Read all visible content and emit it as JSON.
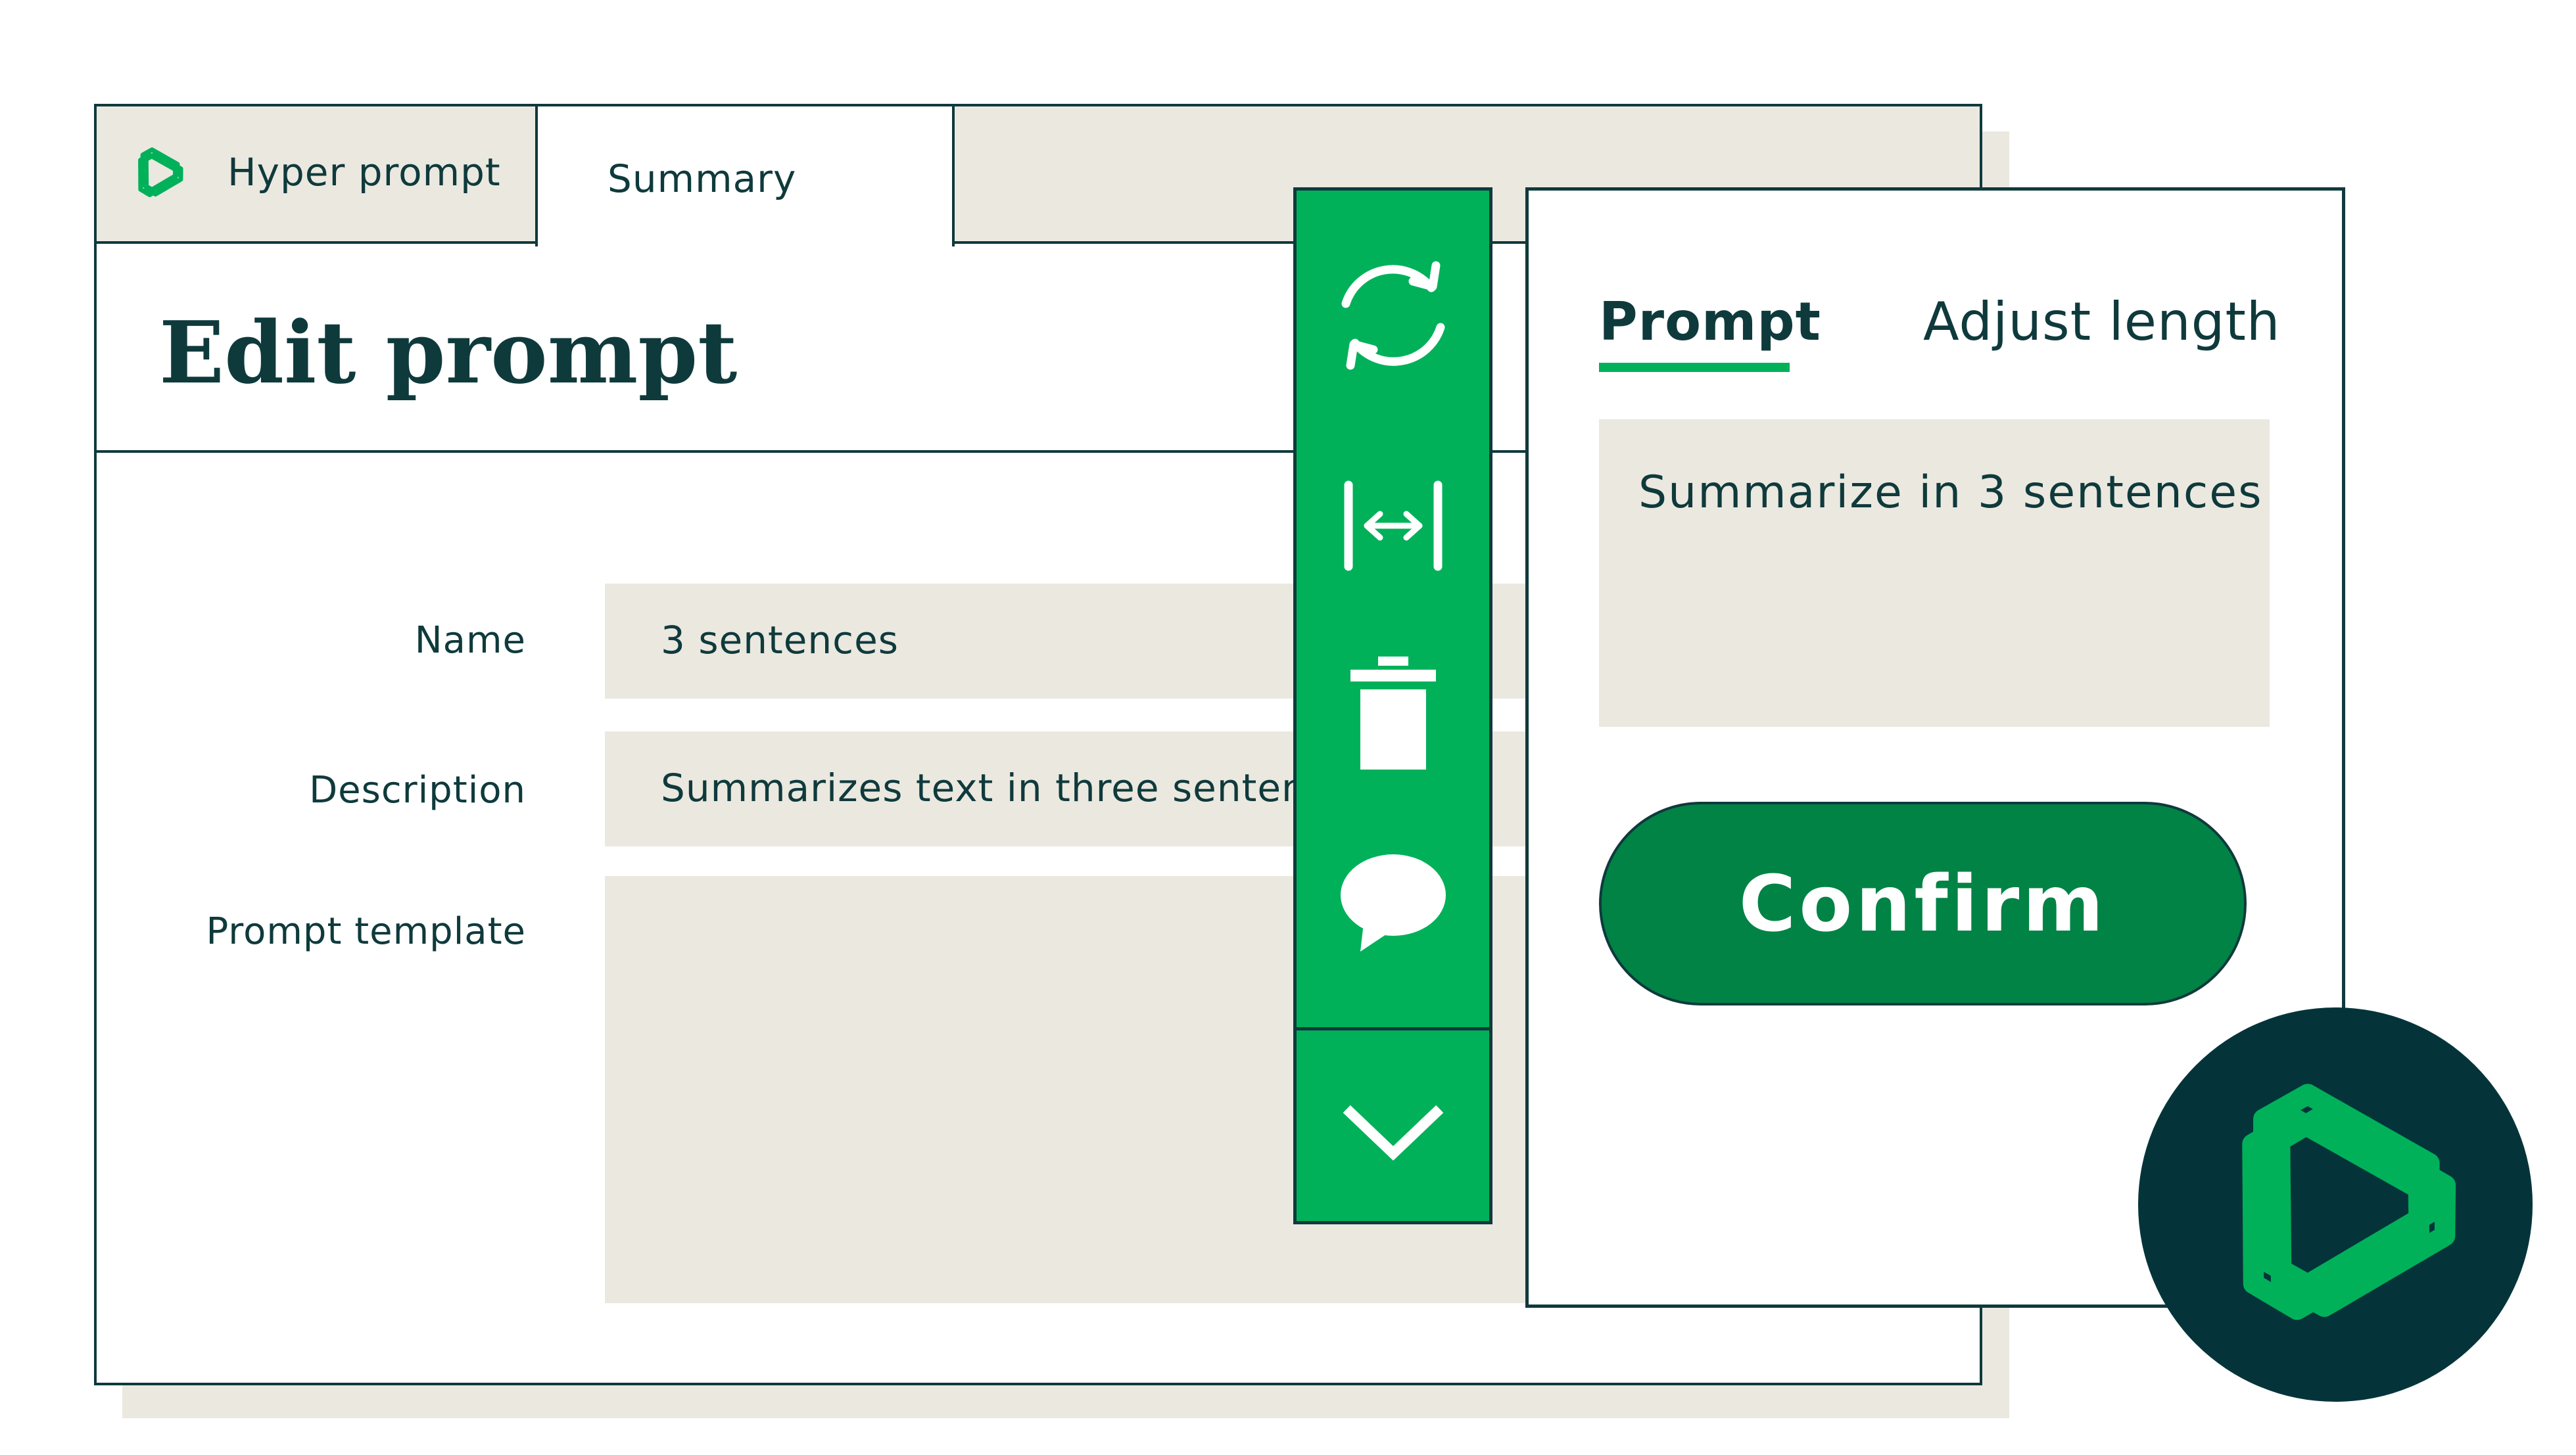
{
  "tabs": [
    {
      "label": "Hyper prompt",
      "icon": "openai-logo-icon"
    },
    {
      "label": "Summary"
    }
  ],
  "page_title": "Edit prompt",
  "form": {
    "name": {
      "label": "Name",
      "value": "3 sentences"
    },
    "description": {
      "label": "Description",
      "value": "Summarizes text in three sentences"
    },
    "prompt_template": {
      "label": "Prompt template",
      "value": ""
    }
  },
  "toolbar": {
    "tools": [
      "refresh-icon",
      "adjust-width-icon",
      "trash-icon",
      "comment-icon"
    ],
    "expand": "chevron-down-icon"
  },
  "panel": {
    "tabs": [
      {
        "label": "Prompt",
        "active": true
      },
      {
        "label": "Adjust length",
        "active": false
      }
    ],
    "prompt_text": "Summarize in 3 sentences",
    "confirm_label": "Confirm"
  },
  "badge": {
    "icon": "openai-logo-icon"
  },
  "colors": {
    "accent_green": "#00b15a",
    "button_green": "#008345",
    "dark_teal": "#0f3a3c",
    "badge_bg": "#04343a",
    "field_bg": "#ebe8e0"
  }
}
